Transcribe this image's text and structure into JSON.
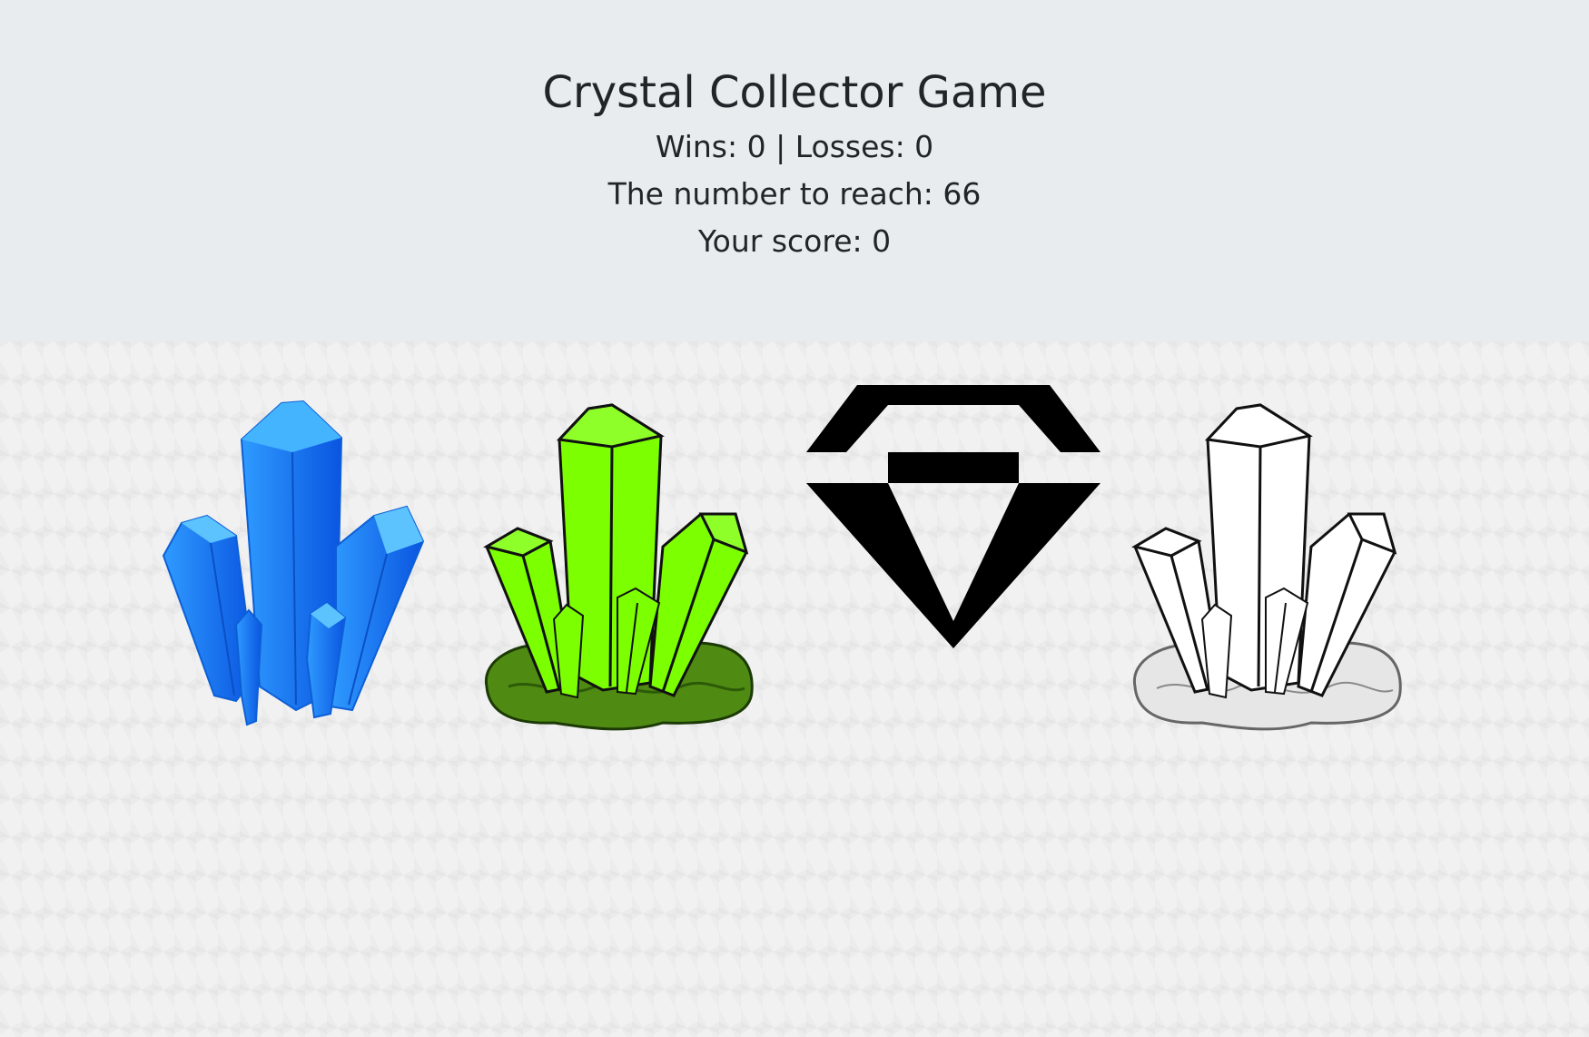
{
  "header": {
    "title": "Crystal Collector Game",
    "wins_losses": "Wins: 0 | Losses: 0",
    "target_line": "The number to reach: 66",
    "score_line": "Your score: 0"
  },
  "crystals": [
    {
      "name": "blue-crystal",
      "color": "#1e88f0"
    },
    {
      "name": "green-crystal",
      "color": "#7cff00"
    },
    {
      "name": "black-diamond",
      "color": "#000000"
    },
    {
      "name": "white-crystal",
      "color": "#ffffff"
    }
  ],
  "colors": {
    "header_bg": "#e9ecef",
    "text": "#212529",
    "play_bg": "#f1f1f1"
  }
}
